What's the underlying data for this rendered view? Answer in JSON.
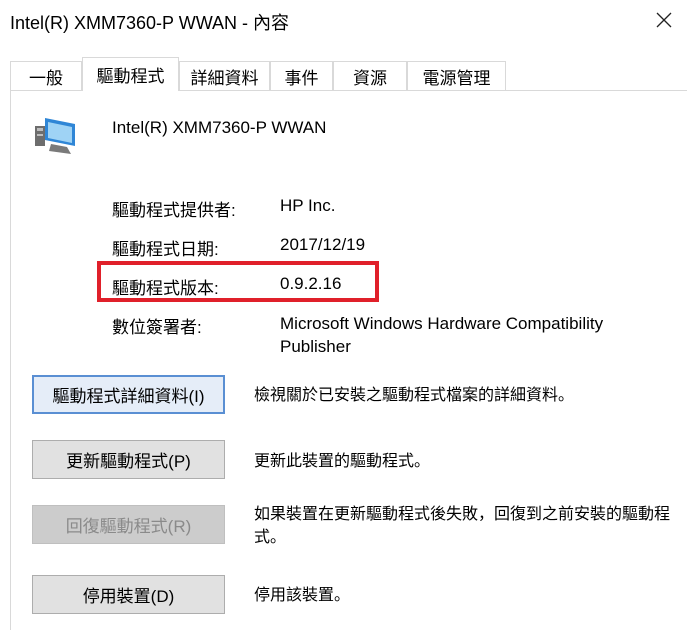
{
  "window": {
    "title": "Intel(R) XMM7360-P WWAN - 內容"
  },
  "tabs": [
    {
      "label": "一般"
    },
    {
      "label": "驅動程式",
      "active": true
    },
    {
      "label": "詳細資料"
    },
    {
      "label": "事件"
    },
    {
      "label": "資源"
    },
    {
      "label": "電源管理"
    }
  ],
  "device": {
    "name": "Intel(R) XMM7360-P WWAN",
    "icon": "network-adapter-icon"
  },
  "properties": {
    "provider_label": "驅動程式提供者:",
    "provider_value": "HP Inc.",
    "date_label": "驅動程式日期:",
    "date_value": "2017/12/19",
    "version_label": "驅動程式版本:",
    "version_value": "0.9.2.16",
    "signer_label": "數位簽署者:",
    "signer_value": "Microsoft Windows Hardware Compatibility Publisher"
  },
  "actions": [
    {
      "button": "驅動程式詳細資料(I)",
      "description": "檢視關於已安裝之驅動程式檔案的詳細資料。"
    },
    {
      "button": "更新驅動程式(P)",
      "description": "更新此裝置的驅動程式。"
    },
    {
      "button": "回復驅動程式(R)",
      "description": "如果裝置在更新驅動程式後失敗，回復到之前安裝的驅動程式。",
      "disabled": true
    },
    {
      "button": "停用裝置(D)",
      "description": "停用該裝置。"
    }
  ],
  "colors": {
    "highlight": "#e0202a",
    "focus": "#5a8fd3"
  }
}
